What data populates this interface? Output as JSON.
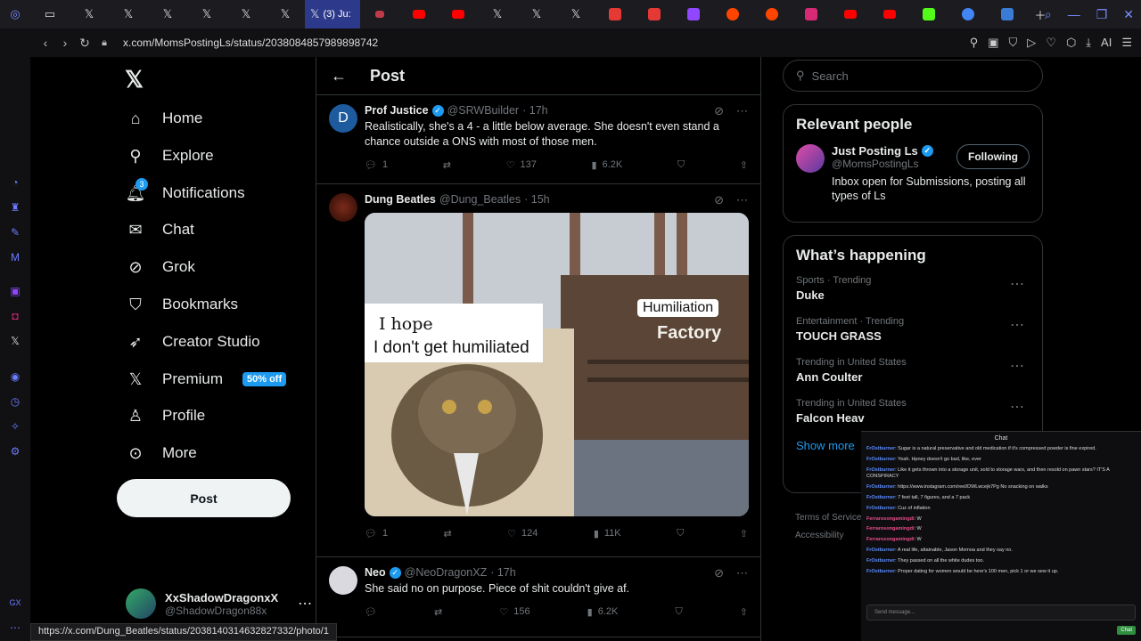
{
  "browser": {
    "active_tab_label": "(3) Ju:",
    "url": "x.com/MomsPostingLs/status/2038084857989898742",
    "status_url": "https://x.com/Dung_Beatles/status/2038140314632827332/photo/1",
    "ai_label": "AI"
  },
  "nav": {
    "items": [
      {
        "label": "Home",
        "icon": "home-icon"
      },
      {
        "label": "Explore",
        "icon": "search-icon"
      },
      {
        "label": "Notifications",
        "icon": "bell-icon"
      },
      {
        "label": "Chat",
        "icon": "mail-icon"
      },
      {
        "label": "Grok",
        "icon": "grok-icon"
      },
      {
        "label": "Bookmarks",
        "icon": "bookmark-icon"
      },
      {
        "label": "Creator Studio",
        "icon": "rocket-icon"
      },
      {
        "label": "Premium",
        "icon": "x-icon"
      },
      {
        "label": "Profile",
        "icon": "person-icon"
      },
      {
        "label": "More",
        "icon": "more-circle-icon"
      }
    ],
    "notifications_badge": "3",
    "premium_badge": "50% off",
    "post_button": "Post"
  },
  "account": {
    "name": "XxShadowDragonxX",
    "handle": "@ShadowDragon88x"
  },
  "main": {
    "title": "Post",
    "tweets": [
      {
        "name": "Prof Justice",
        "handle": "@SRWBuilder",
        "time": "· 17h",
        "avatar_letter": "D",
        "text": "Realistically, she's a 4 - a little below average.  She doesn't even stand a chance outside a ONS with most of those men.",
        "replies": "1",
        "reposts": "",
        "likes": "137",
        "views": "6.2K"
      },
      {
        "name": "Dung Beatles",
        "handle": "@Dung_Beatles",
        "time": "· 15h",
        "meme": {
          "left_line1": "I hope",
          "left_line2": "I don't get humiliated",
          "right_line1": "Humiliation",
          "right_line2": "Factory"
        },
        "replies": "1",
        "reposts": "",
        "likes": "124",
        "views": "11K"
      },
      {
        "name": "Neo",
        "handle": "@NeoDragonXZ",
        "time": "· 17h",
        "text": "She said no on purpose. Piece of shit couldn't give af.",
        "replies": "",
        "reposts": "",
        "likes": "156",
        "views": "6.2K"
      }
    ]
  },
  "right": {
    "search_placeholder": "Search",
    "relevant_title": "Relevant people",
    "relevant": {
      "name": "Just Posting Ls",
      "handle": "@MomsPostingLs",
      "bio": "Inbox open for Submissions, posting all types of Ls",
      "button": "Following"
    },
    "happening_title": "What’s happening",
    "trends": [
      {
        "context": "Sports · Trending",
        "topic": "Duke"
      },
      {
        "context": "Entertainment · Trending",
        "topic": "TOUCH GRASS"
      },
      {
        "context": "Trending in United States",
        "topic": "Ann Coulter"
      },
      {
        "context": "Trending in United States",
        "topic": "Falcon Heav"
      }
    ],
    "show_more": "Show more",
    "footer1": "Terms of Service",
    "footer2": "Accessibility"
  },
  "chat": {
    "title": "Chat",
    "messages": [
      {
        "user": "FrOstburner",
        "text": ": Sugar is a natural preservative and old medication if it's compressed powder is fine expired."
      },
      {
        "user": "FrOstburner",
        "text": ": Yeah. Hpney doesn't go bad, like, ever"
      },
      {
        "user": "FrOstburner",
        "text": ": Like it gets thrown into a storage unit, sold to storage wars, and then resold on pawn stars? IT'S A CONSPIRACY"
      },
      {
        "user": "FrOstburner",
        "text": ": https://www.instagram.com/reel/DWLwcejk7Pg No snacking on walks"
      },
      {
        "user": "FrOstburner",
        "text": ": 7 feet tall, 7 figures, and a 7 pack"
      },
      {
        "user": "FrOstburner",
        "text": ": Cuz of inflation"
      },
      {
        "user": "Ferrarosongamingdi",
        "text": ": W",
        "red": true
      },
      {
        "user": "Ferrarosongamingdi",
        "text": ": W",
        "red": true
      },
      {
        "user": "Ferrarosongamingdi",
        "text": ": W",
        "red": true
      },
      {
        "user": "FrOstburner",
        "text": ": A real life, attainable, Jason Momoa and they say no."
      },
      {
        "user": "FrOstburner",
        "text": ": They passed on all the white dudes too."
      },
      {
        "user": "FrOstburner",
        "text": ": Proper dating for women would be here's 100 men, pick 1 or we sew it up."
      }
    ],
    "send_placeholder": "Send message...",
    "chat_button": "Chat"
  }
}
